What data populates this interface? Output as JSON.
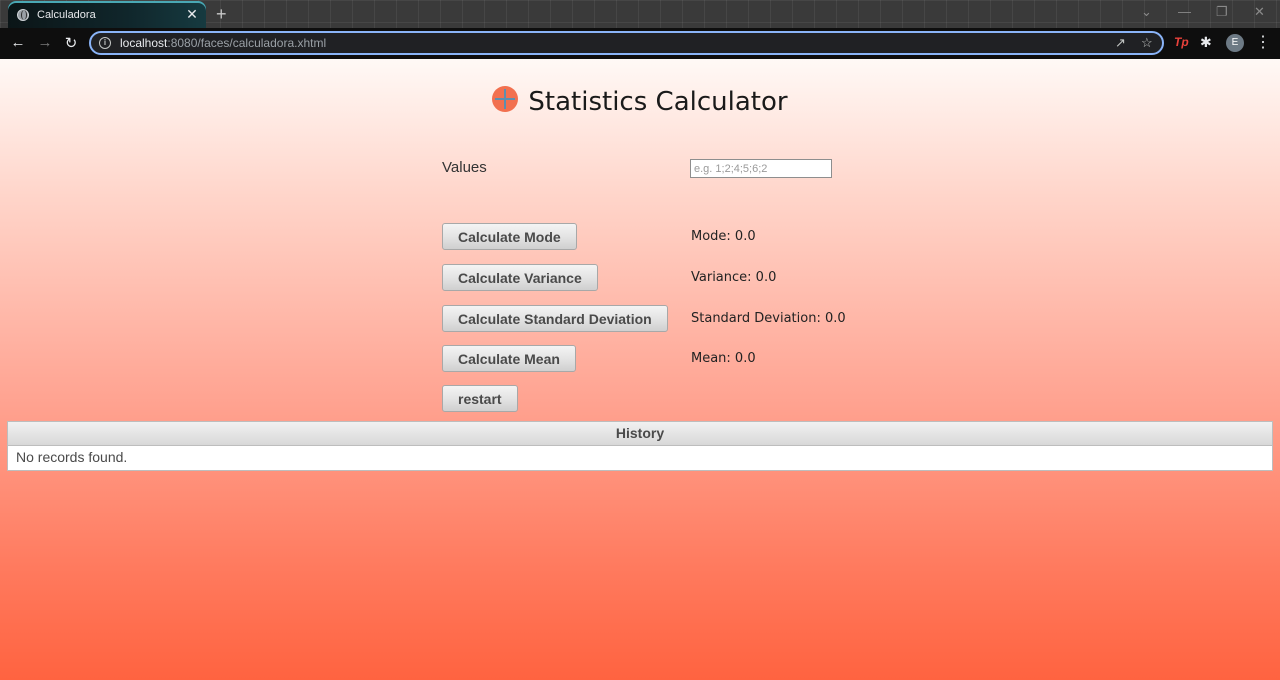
{
  "browser": {
    "tab_title": "Calculadora",
    "tab_close": "✕",
    "new_tab": "+",
    "url_host": "localhost",
    "url_path": ":8080/faces/calculadora.xhtml",
    "extension_label": "Tp",
    "profile_initial": "E",
    "window_controls": [
      "⌄",
      "—",
      "❐",
      "✕"
    ],
    "icons": [
      "back-arrow-icon",
      "forward-arrow-icon",
      "reload-icon",
      "info-icon",
      "share-icon",
      "star-icon",
      "puzzle-icon",
      "menu-dots-icon"
    ]
  },
  "page": {
    "title": "Statistics Calculator",
    "values_label": "Values",
    "values_placeholder": "e.g. 1;2;4;5;6;2",
    "values_value": "",
    "buttons": {
      "mode": "Calculate Mode",
      "variance": "Calculate Variance",
      "std_dev": "Calculate Standard Deviation",
      "mean": "Calculate Mean",
      "restart": "restart"
    },
    "results": {
      "mode": "Mode: 0.0",
      "variance": "Variance: 0.0",
      "std_dev": "Standard Deviation: 0.0",
      "mean": "Mean: 0.0"
    },
    "history": {
      "header": "History",
      "empty_message": "No records found."
    }
  }
}
